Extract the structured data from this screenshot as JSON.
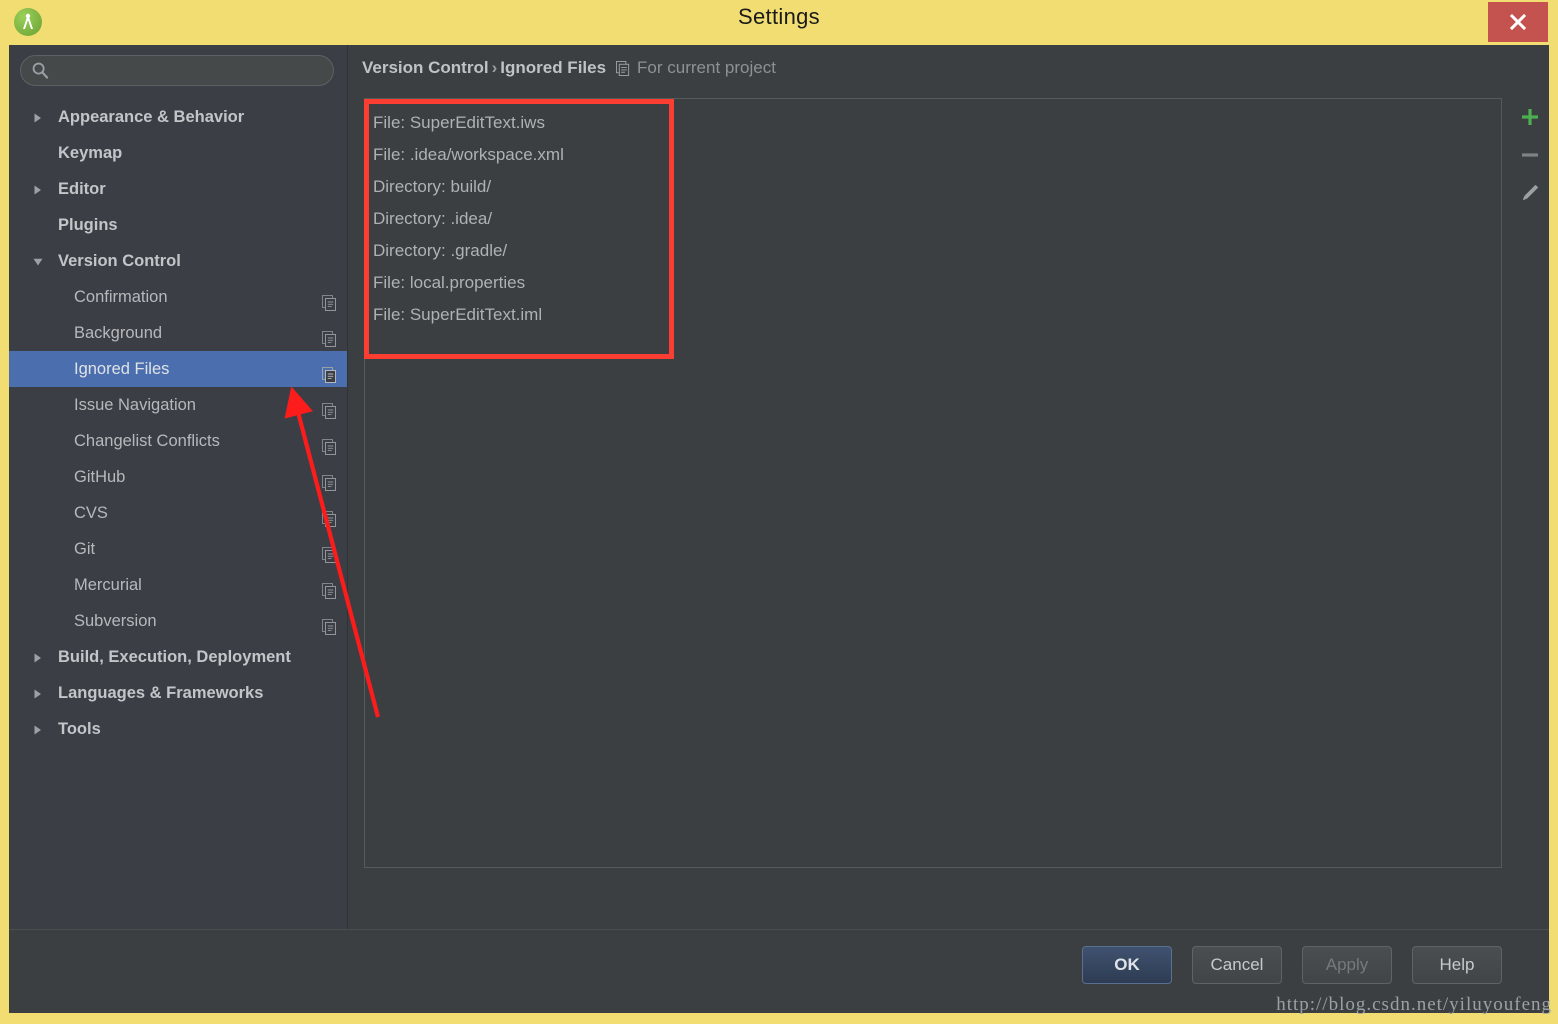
{
  "window": {
    "title": "Settings",
    "app_icon": "android-studio-icon",
    "close_label": "✕",
    "frame_color": "#f2dd72"
  },
  "search": {
    "value": "",
    "placeholder": "",
    "icon": "search-icon"
  },
  "sidebar": {
    "items": [
      {
        "label": "Appearance & Behavior",
        "level": "top",
        "arrow": "right",
        "selected": false,
        "scope_icon": false
      },
      {
        "label": "Keymap",
        "level": "top",
        "arrow": "none",
        "selected": false,
        "scope_icon": false
      },
      {
        "label": "Editor",
        "level": "top",
        "arrow": "right",
        "selected": false,
        "scope_icon": false
      },
      {
        "label": "Plugins",
        "level": "top",
        "arrow": "none",
        "selected": false,
        "scope_icon": false
      },
      {
        "label": "Version Control",
        "level": "top",
        "arrow": "down",
        "selected": false,
        "scope_icon": false
      },
      {
        "label": "Confirmation",
        "level": "sub",
        "arrow": "none",
        "selected": false,
        "scope_icon": true
      },
      {
        "label": "Background",
        "level": "sub",
        "arrow": "none",
        "selected": false,
        "scope_icon": true
      },
      {
        "label": "Ignored Files",
        "level": "sub",
        "arrow": "none",
        "selected": true,
        "scope_icon": true
      },
      {
        "label": "Issue Navigation",
        "level": "sub",
        "arrow": "none",
        "selected": false,
        "scope_icon": true
      },
      {
        "label": "Changelist Conflicts",
        "level": "sub",
        "arrow": "none",
        "selected": false,
        "scope_icon": true
      },
      {
        "label": "GitHub",
        "level": "sub",
        "arrow": "none",
        "selected": false,
        "scope_icon": true
      },
      {
        "label": "CVS",
        "level": "sub",
        "arrow": "none",
        "selected": false,
        "scope_icon": true
      },
      {
        "label": "Git",
        "level": "sub",
        "arrow": "none",
        "selected": false,
        "scope_icon": true
      },
      {
        "label": "Mercurial",
        "level": "sub",
        "arrow": "none",
        "selected": false,
        "scope_icon": true
      },
      {
        "label": "Subversion",
        "level": "sub",
        "arrow": "none",
        "selected": false,
        "scope_icon": true
      },
      {
        "label": "Build, Execution, Deployment",
        "level": "top",
        "arrow": "right",
        "selected": false,
        "scope_icon": false
      },
      {
        "label": "Languages & Frameworks",
        "level": "top",
        "arrow": "right",
        "selected": false,
        "scope_icon": false
      },
      {
        "label": "Tools",
        "level": "top",
        "arrow": "right",
        "selected": false,
        "scope_icon": false
      }
    ]
  },
  "breadcrumb": {
    "parent": "Version Control",
    "separator": "›",
    "current": "Ignored Files",
    "scope_icon": "project-scope-icon",
    "scope_text": "For current project"
  },
  "ignored_files": {
    "rows": [
      "File: SuperEditText.iws",
      "File: .idea/workspace.xml",
      "Directory: build/",
      "Directory: .idea/",
      "Directory: .gradle/",
      "File: local.properties",
      "File: SuperEditText.iml"
    ]
  },
  "toolbar": {
    "add": {
      "name": "add-icon",
      "color": "#4caf50",
      "enabled": true
    },
    "remove": {
      "name": "remove-icon",
      "color": "#7d8285",
      "enabled": false
    },
    "edit": {
      "name": "edit-pencil-icon",
      "color": "#9aa0a4",
      "enabled": true
    }
  },
  "footer": {
    "ok": "OK",
    "cancel": "Cancel",
    "apply": "Apply",
    "help": "Help",
    "apply_enabled": false,
    "watermark": "http://blog.csdn.net/yiluyoufeng"
  },
  "annotation": {
    "highlight_color": "#fc3d32",
    "target": "Ignored Files"
  }
}
